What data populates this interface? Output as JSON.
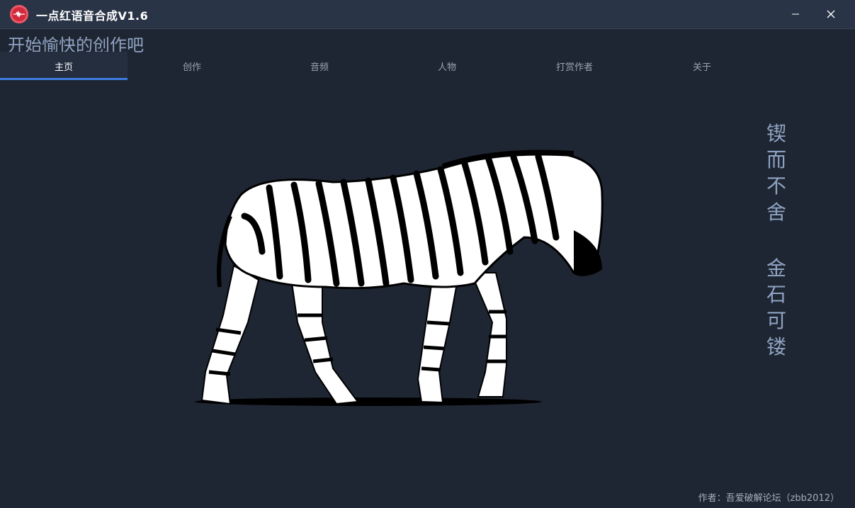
{
  "window": {
    "title": "一点红语音合成V1.6",
    "minimize_icon": "minimize-icon",
    "close_icon": "close-icon"
  },
  "header": {
    "subtitle": "开始愉快的创作吧"
  },
  "tabs": [
    {
      "label": "主页",
      "active": true
    },
    {
      "label": "创作",
      "active": false
    },
    {
      "label": "音频",
      "active": false
    },
    {
      "label": "人物",
      "active": false
    },
    {
      "label": "打赏作者",
      "active": false
    },
    {
      "label": "关于",
      "active": false
    }
  ],
  "main": {
    "image": "zebra-image",
    "motto_line1": [
      "锲",
      "而",
      "不",
      "舍"
    ],
    "motto_line2": [
      "金",
      "石",
      "可",
      "镂"
    ]
  },
  "footer": {
    "author": "作者：吾爱破解论坛（zbb2012）"
  },
  "colors": {
    "background": "#1f2633",
    "titlebar": "#2a3447",
    "accent": "#3d7be0",
    "app_icon": "#d12a3c",
    "motto": "#8fa3c2"
  }
}
